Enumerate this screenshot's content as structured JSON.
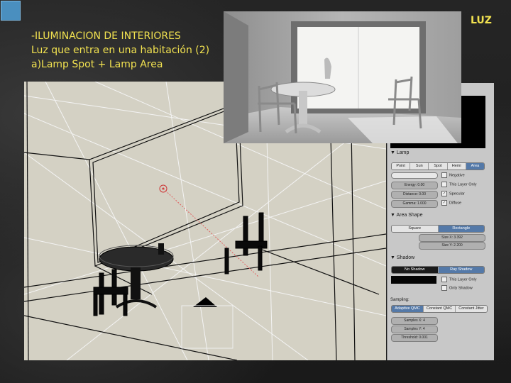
{
  "slide": {
    "title_line1": "-ILUMINACION DE INTERIORES",
    "title_line2": "Luz que entra en una habitación (2)",
    "title_line3": "a)Lamp Spot  + Lamp Area",
    "corner_label": "LUZ",
    "accent_color": "#f2e250"
  },
  "panel": {
    "lamp_section": "Lamp",
    "lamp_types": [
      "Point",
      "Sun",
      "Spot",
      "Hemi",
      "Area"
    ],
    "lamp_selected": "Area",
    "energy": "Energy: 0.00",
    "distance": "Distance: 0.00",
    "gamma": "Gamma: 1.000",
    "negative": "Negative",
    "this_layer_only": "This Layer Only",
    "specular": "Specular",
    "diffuse": "Diffuse",
    "area_shape_section": "Area Shape",
    "shape_options": [
      "Square",
      "Rectangle"
    ],
    "shape_selected": "Rectangle",
    "size_x": "Size X: 3.392",
    "size_y": "Size Y: 2.200",
    "shadow_section": "Shadow",
    "shadow_options": [
      "No Shadow",
      "Ray Shadow"
    ],
    "shadow_selected": "Ray Shadow",
    "shadow_this_layer": "This Layer Only",
    "only_shadow": "Only Shadow",
    "sampling_label": "Sampling:",
    "sampling_options": [
      "Adaptive QMC",
      "Constant QMC",
      "Constant Jitter"
    ],
    "sampling_selected": "Adaptive QMC",
    "samples_x": "Samples X: 4",
    "samples_y": "Samples Y: 4",
    "threshold": "Threshold: 0.001"
  }
}
